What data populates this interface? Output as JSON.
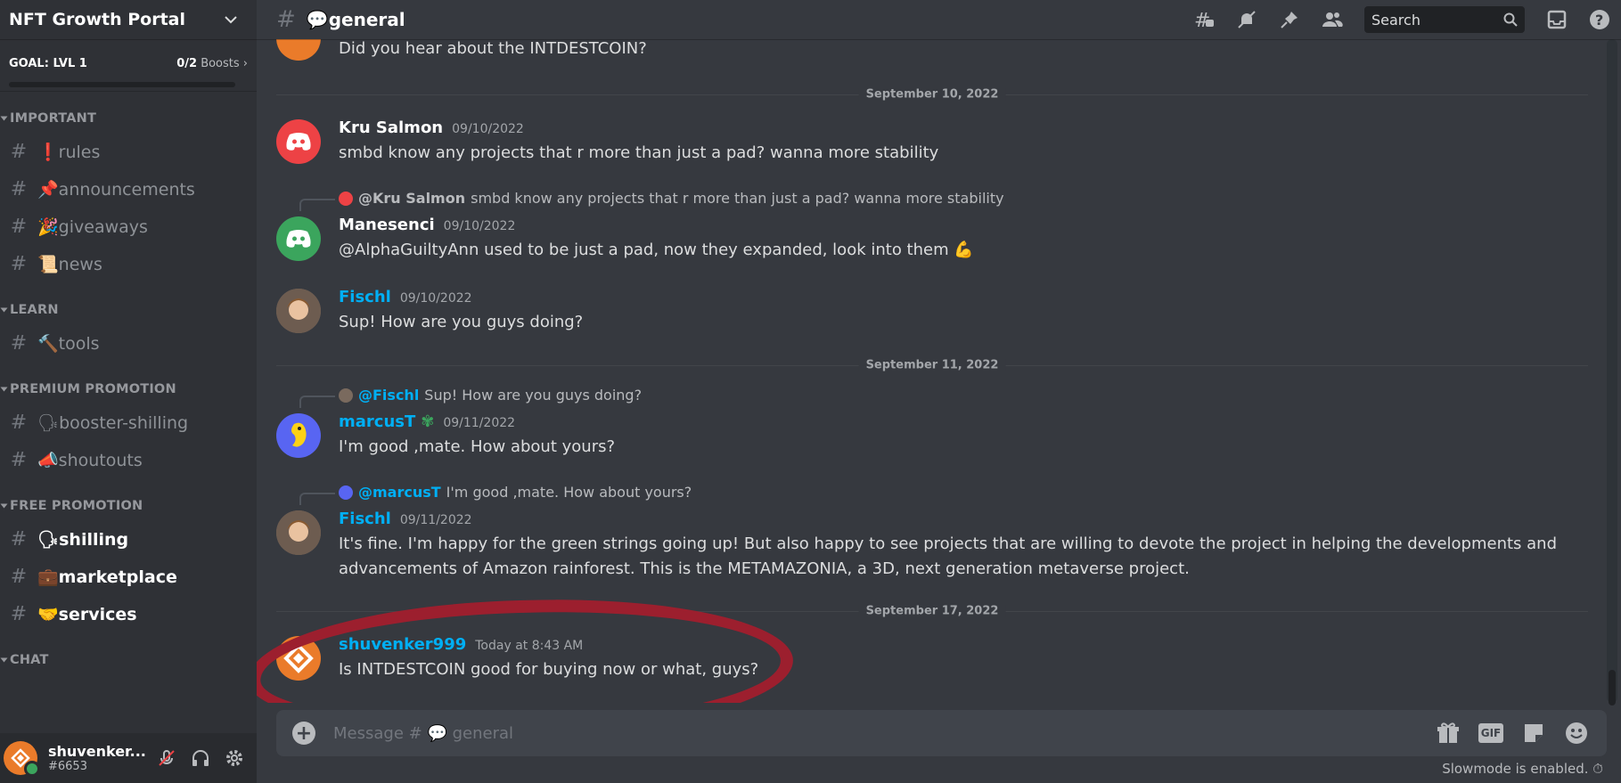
{
  "sidebar": {
    "guild_name": "NFT Growth Portal",
    "goal": {
      "title": "GOAL: LVL 1",
      "boosts_count": "0/2",
      "boosts_label": "Boosts",
      "progress_fraction": 0
    },
    "categories": [
      {
        "label": "IMPORTANT",
        "channels": [
          {
            "emoji": "❗",
            "name": "rules"
          },
          {
            "emoji": "📌",
            "name": "announcements"
          },
          {
            "emoji": "🎉",
            "name": "giveaways"
          },
          {
            "emoji": "📜",
            "name": "news"
          }
        ]
      },
      {
        "label": "LEARN",
        "channels": [
          {
            "emoji": "🔨",
            "name": "tools"
          }
        ]
      },
      {
        "label": "PREMIUM PROMOTION",
        "channels": [
          {
            "emoji": "🗣",
            "name": "booster-shilling"
          },
          {
            "emoji": "📣",
            "name": "shoutouts"
          }
        ]
      },
      {
        "label": "FREE PROMOTION",
        "channels": [
          {
            "emoji": "🗣",
            "name": "shilling"
          },
          {
            "emoji": "💼",
            "name": "marketplace"
          },
          {
            "emoji": "🤝",
            "name": "services"
          }
        ]
      },
      {
        "label": "CHAT",
        "channels": []
      }
    ],
    "user": {
      "name": "shuvenker...",
      "tag": "#6653"
    }
  },
  "header": {
    "channel_emoji": "💬",
    "channel_name": "general",
    "search_placeholder": "Search"
  },
  "messages": {
    "top_partial": "Did you hear about the INTDESTCOIN?",
    "divider1": "September 10, 2022",
    "m1": {
      "author": "Kru Salmon",
      "time": "09/10/2022",
      "text": "smbd know any projects that r more than just a pad? wanna more stability"
    },
    "m2_reply": {
      "author": "@Kru Salmon",
      "text": "smbd know any projects that r more than just a pad? wanna more stability"
    },
    "m2": {
      "author": "Manesenci",
      "time": "09/10/2022",
      "text": "@AlphaGuiltyAnn used to be just a pad, now they expanded, look into them 💪"
    },
    "m3": {
      "author": "Fischl",
      "time": "09/10/2022",
      "text": "Sup! How are you guys doing?"
    },
    "divider2": "September 11, 2022",
    "m4_reply": {
      "author": "@Fischl",
      "text": "Sup! How are you guys doing?"
    },
    "m4": {
      "author": "marcusT",
      "time": "09/11/2022",
      "text": "I'm good ,mate. How about yours?"
    },
    "m5_reply": {
      "author": "@marcusT",
      "text": "I'm good ,mate. How about yours?"
    },
    "m5": {
      "author": "Fischl",
      "time": "09/11/2022",
      "text_line1": "It's fine. I'm happy for the green strings going up! But also happy to see projects that are willing to devote the project in helping the developments and",
      "text_line2": "advancements of Amazon rainforest. This is the METAMAZONIA, a 3D, next generation metaverse project."
    },
    "divider3": "September 17, 2022",
    "m6": {
      "author": "shuvenker999",
      "time": "Today at 8:43 AM",
      "text": "Is INTDESTCOIN good for buying now or what, guys?"
    }
  },
  "composer": {
    "placeholder_prefix": "Message #",
    "placeholder_emoji": "💬",
    "placeholder_channel": "general",
    "gif_label": "GIF"
  },
  "slowmode": "Slowmode is enabled.",
  "colors": {
    "discord_red": "#ed4245",
    "discord_green": "#3ba55d",
    "link_blue": "#00aff4",
    "annotation_red": "#9c1f2e",
    "orange": "#ea7b2a"
  }
}
